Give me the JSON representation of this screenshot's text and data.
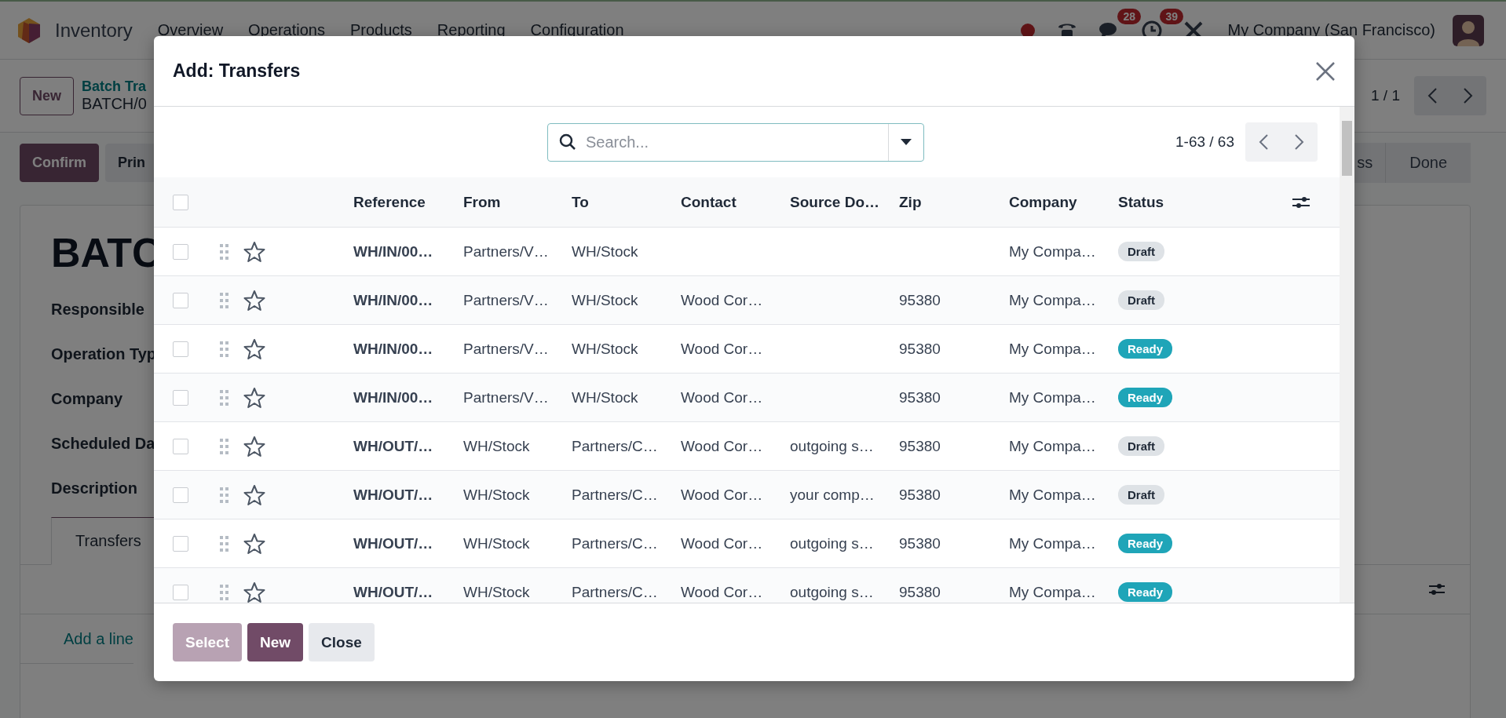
{
  "page": {
    "navbar": {
      "app_name": "Inventory",
      "menu": [
        "Overview",
        "Operations",
        "Products",
        "Reporting",
        "Configuration"
      ],
      "chat_badge": "28",
      "activity_badge": "39",
      "company": "My Company (San Francisco)"
    },
    "control_panel": {
      "new_button": "New",
      "breadcrumb_parent": "Batch Tra",
      "breadcrumb_current": "BATCH/0",
      "pager": "1 / 1"
    },
    "actions": [
      "Confirm",
      "Prin"
    ],
    "stages": [
      {
        "label": "ss",
        "selected": false
      },
      {
        "label": "Done",
        "selected": false
      }
    ],
    "form": {
      "title": "BATC",
      "fields": [
        "Responsible",
        "Operation Typ",
        "Company",
        "Scheduled Da",
        "Description"
      ],
      "tabs": [
        {
          "label": "Transfers",
          "selected": true
        }
      ],
      "add_line": "Add a line"
    }
  },
  "dialog": {
    "title": "Add: Transfers",
    "search": {
      "placeholder": "Search..."
    },
    "pager": "1-63 / 63",
    "header_checkbox": {
      "checked": false
    },
    "columns": [
      "Reference",
      "From",
      "To",
      "Contact",
      "Source Do…",
      "Zip",
      "Company",
      "Status"
    ],
    "rows": [
      {
        "selected": false,
        "starred": false,
        "reference": "WH/IN/00…",
        "from": "Partners/V…",
        "to": "WH/Stock",
        "contact": "",
        "source_document": "",
        "zip": "",
        "company": "My Compa…",
        "status": {
          "label": "Draft",
          "kind": "draft"
        }
      },
      {
        "selected": false,
        "starred": false,
        "reference": "WH/IN/00…",
        "from": "Partners/V…",
        "to": "WH/Stock",
        "contact": "Wood Cor…",
        "source_document": "",
        "zip": "95380",
        "company": "My Compa…",
        "status": {
          "label": "Draft",
          "kind": "draft"
        }
      },
      {
        "selected": false,
        "starred": false,
        "reference": "WH/IN/00…",
        "from": "Partners/V…",
        "to": "WH/Stock",
        "contact": "Wood Cor…",
        "source_document": "",
        "zip": "95380",
        "company": "My Compa…",
        "status": {
          "label": "Ready",
          "kind": "ready"
        }
      },
      {
        "selected": false,
        "starred": false,
        "reference": "WH/IN/00…",
        "from": "Partners/V…",
        "to": "WH/Stock",
        "contact": "Wood Cor…",
        "source_document": "",
        "zip": "95380",
        "company": "My Compa…",
        "status": {
          "label": "Ready",
          "kind": "ready"
        }
      },
      {
        "selected": false,
        "starred": false,
        "reference": "WH/OUT/…",
        "from": "WH/Stock",
        "to": "Partners/C…",
        "contact": "Wood Cor…",
        "source_document": "outgoing s…",
        "zip": "95380",
        "company": "My Compa…",
        "status": {
          "label": "Draft",
          "kind": "draft"
        }
      },
      {
        "selected": false,
        "starred": false,
        "reference": "WH/OUT/…",
        "from": "WH/Stock",
        "to": "Partners/C…",
        "contact": "Wood Cor…",
        "source_document": "your comp…",
        "zip": "95380",
        "company": "My Compa…",
        "status": {
          "label": "Draft",
          "kind": "draft"
        }
      },
      {
        "selected": false,
        "starred": false,
        "reference": "WH/OUT/…",
        "from": "WH/Stock",
        "to": "Partners/C…",
        "contact": "Wood Cor…",
        "source_document": "outgoing s…",
        "zip": "95380",
        "company": "My Compa…",
        "status": {
          "label": "Ready",
          "kind": "ready"
        }
      },
      {
        "selected": false,
        "starred": false,
        "reference": "WH/OUT/…",
        "from": "WH/Stock",
        "to": "Partners/C…",
        "contact": "Wood Cor…",
        "source_document": "outgoing s…",
        "zip": "95380",
        "company": "My Compa…",
        "status": {
          "label": "Ready",
          "kind": "ready"
        }
      }
    ],
    "buttons": [
      {
        "label": "Select",
        "kind": "primary",
        "disabled": true
      },
      {
        "label": "New",
        "kind": "primary",
        "disabled": false
      },
      {
        "label": "Close",
        "kind": "secondary",
        "disabled": false
      }
    ]
  }
}
